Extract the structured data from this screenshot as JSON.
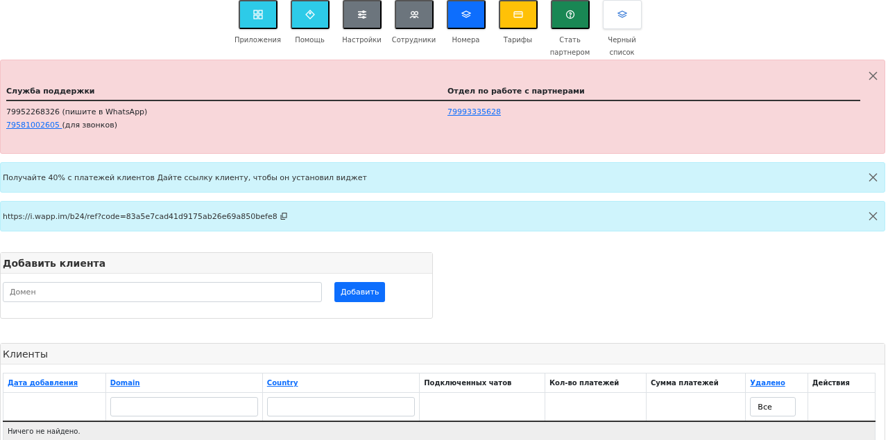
{
  "tiles": [
    {
      "label": "Приложения",
      "color": "#2dcbe8"
    },
    {
      "label": "Помощь",
      "color": "#2dcbe8"
    },
    {
      "label": "Настройки",
      "color": "#6c757d"
    },
    {
      "label": "Сотрудники",
      "color": "#6c757d"
    },
    {
      "label": "Номера",
      "color": "#0d6efd"
    },
    {
      "label": "Тарифы",
      "color": "#ffc107"
    },
    {
      "label": "Стать партнером",
      "color": "#198754"
    },
    {
      "label": "Черный список",
      "color": "#ffffff"
    }
  ],
  "contacts_alert": {
    "columns": [
      {
        "heading": "Служба поддержки",
        "lines": [
          {
            "parts": [
              {
                "text": "79952268326",
                "link": false
              },
              {
                "text": " (пишите в WhatsApp)",
                "link": false
              }
            ]
          },
          {
            "parts": [
              {
                "text": "79581002605 ",
                "link": true
              },
              {
                "text": "(для звонков)",
                "link": false
              }
            ]
          }
        ]
      },
      {
        "heading": "Отдел по работе с партнерами",
        "lines": [
          {
            "parts": [
              {
                "text": "79993335628",
                "link": true
              }
            ]
          }
        ]
      }
    ]
  },
  "info_alert": {
    "text": "Получайте 40% с платежей клиентов Дайте ссылку клиенту, чтобы он установил виджет"
  },
  "link_alert": {
    "text": "https://i.wapp.im/b24/ref?code=83a5e7cad41d9175ab26e69a850befe8"
  },
  "add_client": {
    "title": "Добавить клиента",
    "placeholder": "Домен",
    "button": "Добавить"
  },
  "clients": {
    "title": "Клиенты",
    "columns": [
      {
        "label": "Дата добавления",
        "sortable": true
      },
      {
        "label": "Domain",
        "sortable": true
      },
      {
        "label": "Country",
        "sortable": true
      },
      {
        "label": "Подключенных чатов",
        "sortable": false
      },
      {
        "label": "Кол-во платежей",
        "sortable": false
      },
      {
        "label": "Сумма платежей",
        "sortable": false
      },
      {
        "label": "Удалено",
        "sortable": true
      },
      {
        "label": "Действия",
        "sortable": false
      }
    ],
    "filters": [
      {
        "kind": "empty"
      },
      {
        "kind": "input"
      },
      {
        "kind": "input"
      },
      {
        "kind": "empty"
      },
      {
        "kind": "empty"
      },
      {
        "kind": "empty"
      },
      {
        "kind": "select",
        "value": "Все"
      },
      {
        "kind": "empty"
      }
    ],
    "empty_text": "Ничего не найдено."
  }
}
